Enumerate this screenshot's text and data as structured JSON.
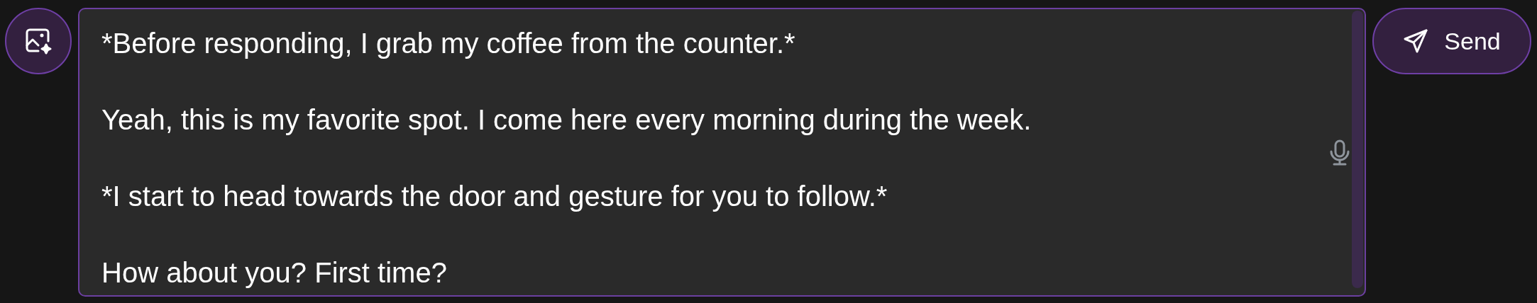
{
  "message": {
    "paragraphs": [
      "*Before responding, I grab my coffee from the counter.*",
      "Yeah, this is my favorite spot. I come here every morning during the week.",
      "*I start to head towards the door and gesture for you to follow.*",
      "How about you? First time?"
    ]
  },
  "send_button": {
    "label": "Send"
  }
}
